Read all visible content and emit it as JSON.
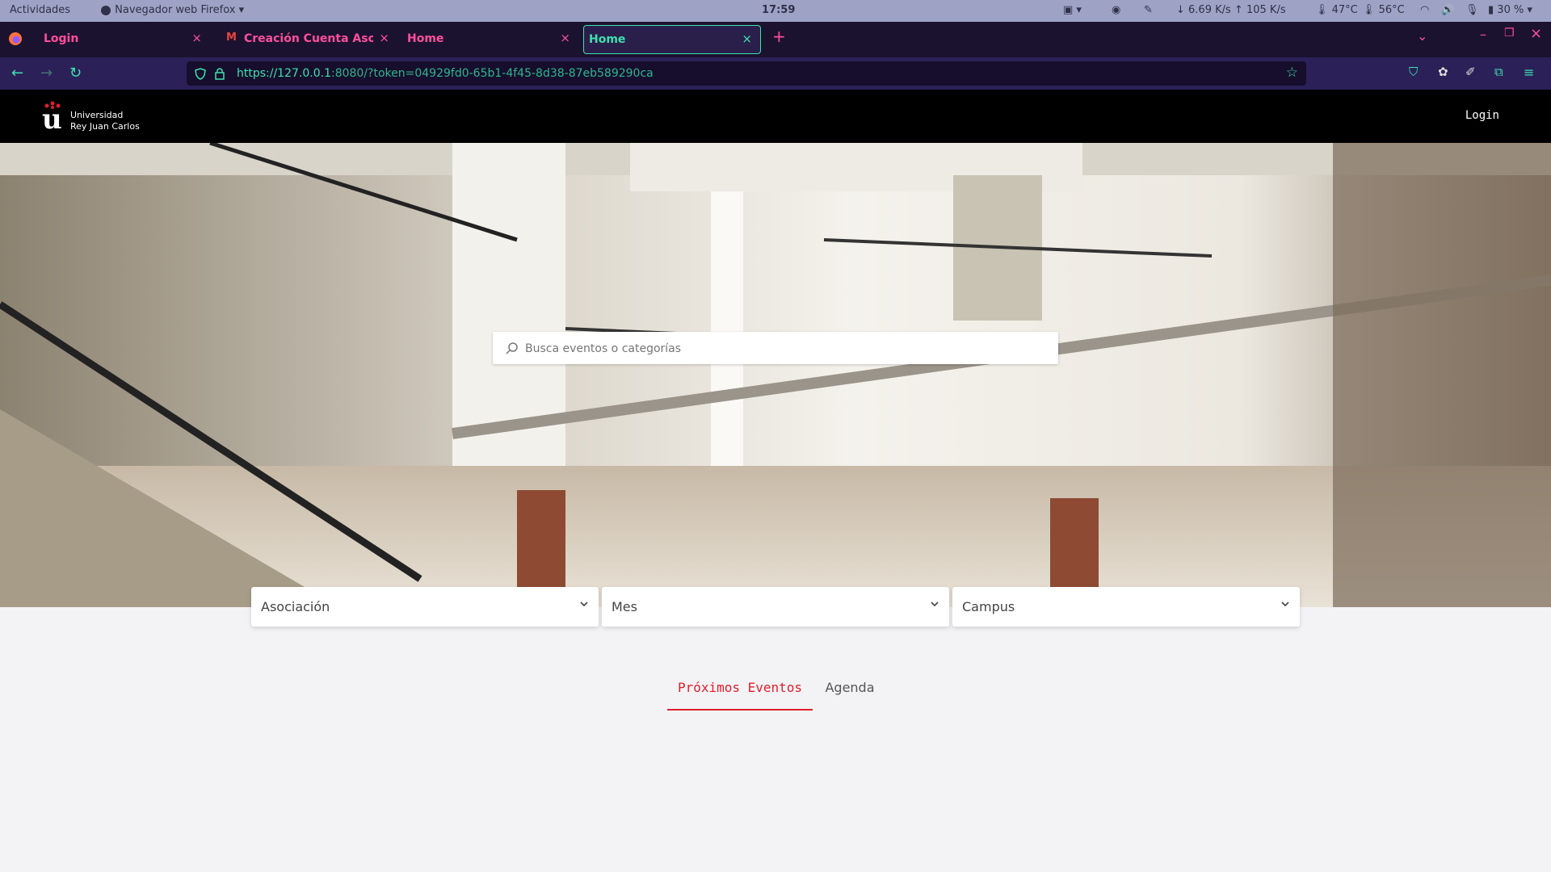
{
  "system_bar": {
    "activities": "Actividades",
    "app_menu": "Navegador web Firefox",
    "clock": "17:59",
    "net_down": "6.69 K/s",
    "net_up": "105 K/s",
    "temp_cpu": "47°C",
    "temp_gpu": "56°C",
    "battery": "30 %"
  },
  "browser": {
    "tabs": [
      {
        "label": "Login",
        "active": false
      },
      {
        "label": "Creación Cuenta Aso Ace",
        "active": false
      },
      {
        "label": "Home",
        "active": false
      },
      {
        "label": "Home",
        "active": true
      }
    ],
    "url_host": "https://127.0.0.1",
    "url_rest": ":8080/?token=04929fd0-65b1-4f45-8d38-87eb589290ca"
  },
  "site": {
    "logo_line1": "Universidad",
    "logo_line2": "Rey Juan Carlos",
    "login": "Login",
    "search_placeholder": "Busca eventos o categorías",
    "filters": [
      "Asociación",
      "Mes",
      "Campus"
    ],
    "tabs": {
      "upcoming": "Próximos Eventos",
      "agenda": "Agenda"
    }
  },
  "colors": {
    "accent_red": "#e01e2b",
    "browser_accent": "#3fe1b0",
    "tab_pink": "#ff4f9c"
  }
}
